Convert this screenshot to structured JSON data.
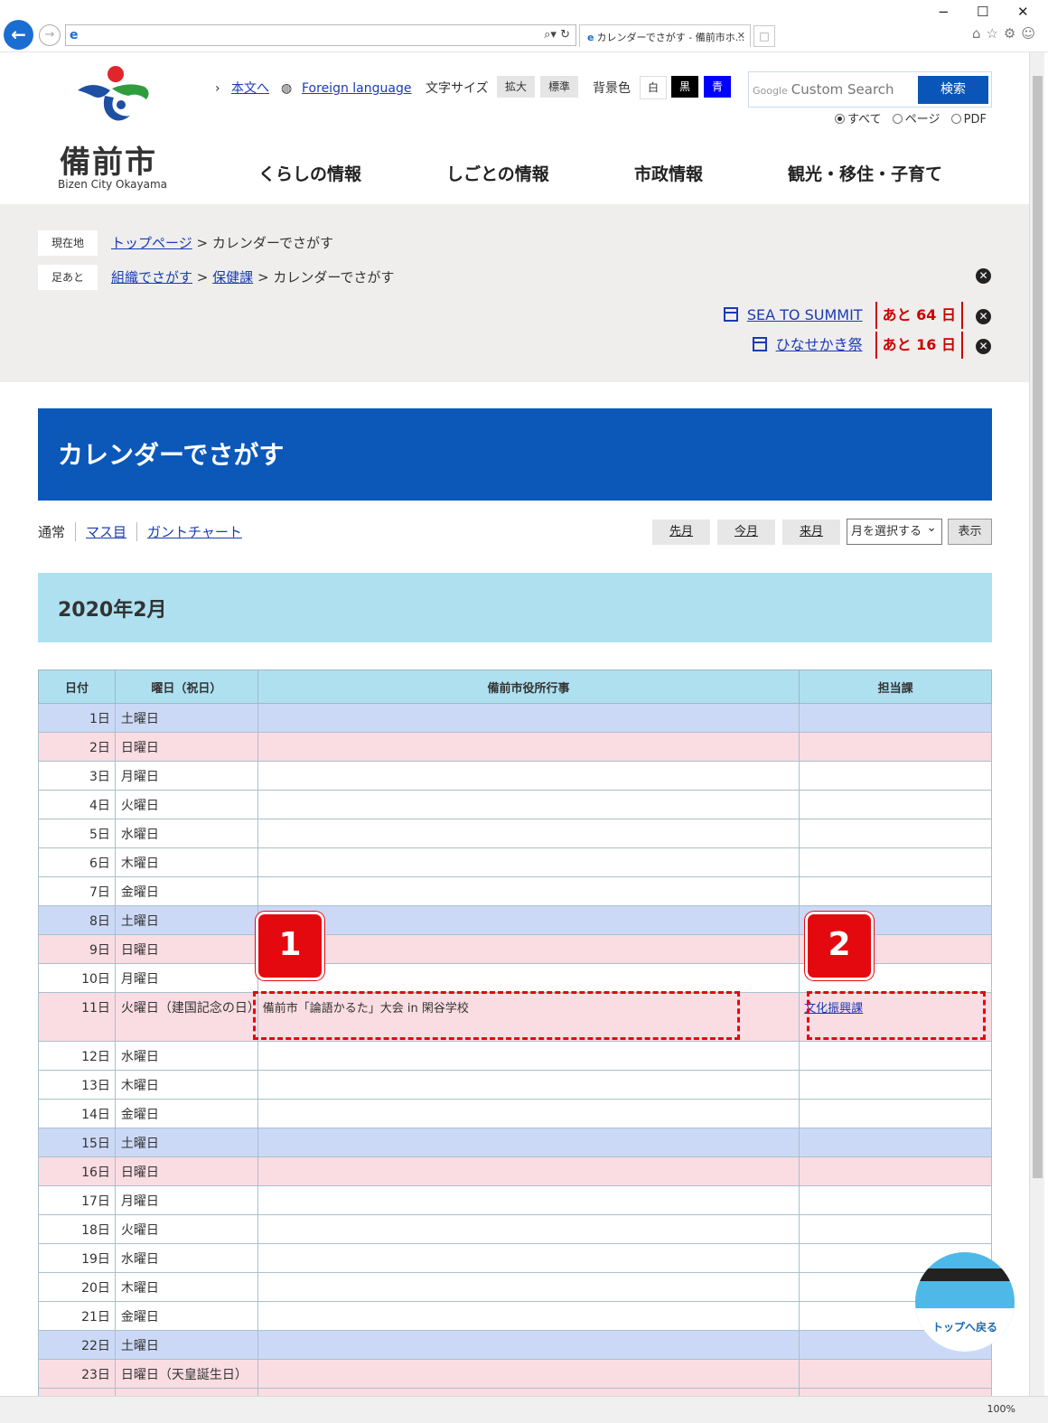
{
  "browser": {
    "window_controls": {
      "minimize": "−",
      "maximize": "☐",
      "close": "✕"
    },
    "tab_title": "カレンダーでさがす - 備前市ホ...",
    "zoom": "100%"
  },
  "header": {
    "logo_name": "備前市",
    "logo_sub": "Bizen City Okayama",
    "skip_link": "本文へ",
    "foreign_language": "Foreign language",
    "font_size_label": "文字サイズ",
    "font_size_large": "拡大",
    "font_size_normal": "標準",
    "bg_color_label": "背景色",
    "bg_white": "白",
    "bg_black": "黒",
    "bg_blue": "青",
    "search_google": "Google",
    "search_placeholder": "Custom Search",
    "search_button": "検索",
    "search_scope": [
      "すべて",
      "ページ",
      "PDF"
    ],
    "nav": [
      "くらしの情報",
      "しごとの情報",
      "市政情報",
      "観光・移住・子育て"
    ]
  },
  "breadcrumb": {
    "current_label": "現在地",
    "current_top": "トップページ",
    "current_page": "カレンダーでさがす",
    "history_label": "足あと",
    "history_1": "組織でさがす",
    "history_2": "保健課",
    "history_3": "カレンダーでさがす",
    "sep": ">"
  },
  "countdowns": [
    {
      "name": "SEA TO SUMMIT",
      "remaining": "あと 64 日"
    },
    {
      "name": "ひなせかき祭",
      "remaining": "あと 16 日"
    }
  ],
  "page_title": "カレンダーでさがす",
  "views": {
    "normal": "通常",
    "grid": "マス目",
    "gantt": "ガントチャート"
  },
  "month_nav": {
    "prev": "先月",
    "this": "今月",
    "next": "来月",
    "select": "月を選択する",
    "show": "表示"
  },
  "month_heading": "2020年2月",
  "table": {
    "headers": [
      "日付",
      "曜日（祝日）",
      "備前市役所行事",
      "担当課"
    ],
    "rows": [
      {
        "date": "1日",
        "day": "土曜日",
        "type": "sat",
        "event": "",
        "dept": ""
      },
      {
        "date": "2日",
        "day": "日曜日",
        "type": "sun",
        "event": "",
        "dept": ""
      },
      {
        "date": "3日",
        "day": "月曜日",
        "type": "",
        "event": "",
        "dept": ""
      },
      {
        "date": "4日",
        "day": "火曜日",
        "type": "",
        "event": "",
        "dept": ""
      },
      {
        "date": "5日",
        "day": "水曜日",
        "type": "",
        "event": "",
        "dept": ""
      },
      {
        "date": "6日",
        "day": "木曜日",
        "type": "",
        "event": "",
        "dept": ""
      },
      {
        "date": "7日",
        "day": "金曜日",
        "type": "",
        "event": "",
        "dept": ""
      },
      {
        "date": "8日",
        "day": "土曜日",
        "type": "sat",
        "event": "",
        "dept": ""
      },
      {
        "date": "9日",
        "day": "日曜日",
        "type": "sun",
        "event": "",
        "dept": ""
      },
      {
        "date": "10日",
        "day": "月曜日",
        "type": "",
        "event": "",
        "dept": ""
      },
      {
        "date": "11日",
        "day": "火曜日（建国記念の日）",
        "type": "sun tall",
        "event": "備前市「論語かるた」大会 in 閑谷学校",
        "dept": "文化振興課"
      },
      {
        "date": "12日",
        "day": "水曜日",
        "type": "",
        "event": "",
        "dept": ""
      },
      {
        "date": "13日",
        "day": "木曜日",
        "type": "",
        "event": "",
        "dept": ""
      },
      {
        "date": "14日",
        "day": "金曜日",
        "type": "",
        "event": "",
        "dept": ""
      },
      {
        "date": "15日",
        "day": "土曜日",
        "type": "sat",
        "event": "",
        "dept": ""
      },
      {
        "date": "16日",
        "day": "日曜日",
        "type": "sun",
        "event": "",
        "dept": ""
      },
      {
        "date": "17日",
        "day": "月曜日",
        "type": "",
        "event": "",
        "dept": ""
      },
      {
        "date": "18日",
        "day": "火曜日",
        "type": "",
        "event": "",
        "dept": ""
      },
      {
        "date": "19日",
        "day": "水曜日",
        "type": "",
        "event": "",
        "dept": ""
      },
      {
        "date": "20日",
        "day": "木曜日",
        "type": "",
        "event": "",
        "dept": ""
      },
      {
        "date": "21日",
        "day": "金曜日",
        "type": "",
        "event": "",
        "dept": ""
      },
      {
        "date": "22日",
        "day": "土曜日",
        "type": "sat",
        "event": "",
        "dept": ""
      },
      {
        "date": "23日",
        "day": "日曜日（天皇誕生日）",
        "type": "sun",
        "event": "",
        "dept": ""
      },
      {
        "date": "",
        "day": "",
        "type": "sun",
        "event": "",
        "dept": ""
      }
    ]
  },
  "annotations": [
    "1",
    "2"
  ],
  "back_to_top": "トップへ戻る",
  "colors": {
    "brand_blue": "#0b58b9",
    "month_bg": "#aee0f0",
    "saturday": "#ccd9f6",
    "sunday": "#fadce3",
    "annotation_red": "#e4090f"
  }
}
